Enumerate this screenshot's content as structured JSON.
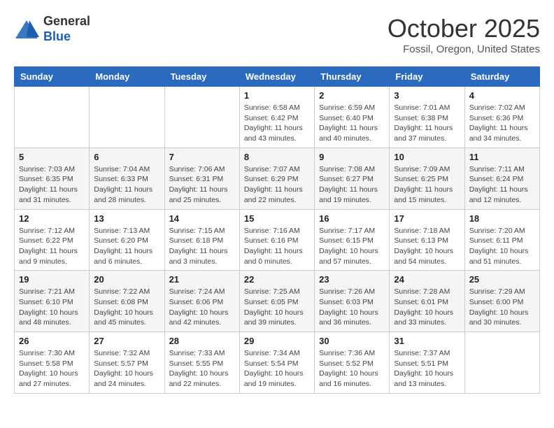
{
  "header": {
    "logo": {
      "line1": "General",
      "line2": "Blue"
    },
    "title": "October 2025",
    "location": "Fossil, Oregon, United States"
  },
  "weekdays": [
    "Sunday",
    "Monday",
    "Tuesday",
    "Wednesday",
    "Thursday",
    "Friday",
    "Saturday"
  ],
  "weeks": [
    [
      {
        "day": "",
        "info": ""
      },
      {
        "day": "",
        "info": ""
      },
      {
        "day": "",
        "info": ""
      },
      {
        "day": "1",
        "info": "Sunrise: 6:58 AM\nSunset: 6:42 PM\nDaylight: 11 hours\nand 43 minutes."
      },
      {
        "day": "2",
        "info": "Sunrise: 6:59 AM\nSunset: 6:40 PM\nDaylight: 11 hours\nand 40 minutes."
      },
      {
        "day": "3",
        "info": "Sunrise: 7:01 AM\nSunset: 6:38 PM\nDaylight: 11 hours\nand 37 minutes."
      },
      {
        "day": "4",
        "info": "Sunrise: 7:02 AM\nSunset: 6:36 PM\nDaylight: 11 hours\nand 34 minutes."
      }
    ],
    [
      {
        "day": "5",
        "info": "Sunrise: 7:03 AM\nSunset: 6:35 PM\nDaylight: 11 hours\nand 31 minutes."
      },
      {
        "day": "6",
        "info": "Sunrise: 7:04 AM\nSunset: 6:33 PM\nDaylight: 11 hours\nand 28 minutes."
      },
      {
        "day": "7",
        "info": "Sunrise: 7:06 AM\nSunset: 6:31 PM\nDaylight: 11 hours\nand 25 minutes."
      },
      {
        "day": "8",
        "info": "Sunrise: 7:07 AM\nSunset: 6:29 PM\nDaylight: 11 hours\nand 22 minutes."
      },
      {
        "day": "9",
        "info": "Sunrise: 7:08 AM\nSunset: 6:27 PM\nDaylight: 11 hours\nand 19 minutes."
      },
      {
        "day": "10",
        "info": "Sunrise: 7:09 AM\nSunset: 6:25 PM\nDaylight: 11 hours\nand 15 minutes."
      },
      {
        "day": "11",
        "info": "Sunrise: 7:11 AM\nSunset: 6:24 PM\nDaylight: 11 hours\nand 12 minutes."
      }
    ],
    [
      {
        "day": "12",
        "info": "Sunrise: 7:12 AM\nSunset: 6:22 PM\nDaylight: 11 hours\nand 9 minutes."
      },
      {
        "day": "13",
        "info": "Sunrise: 7:13 AM\nSunset: 6:20 PM\nDaylight: 11 hours\nand 6 minutes."
      },
      {
        "day": "14",
        "info": "Sunrise: 7:15 AM\nSunset: 6:18 PM\nDaylight: 11 hours\nand 3 minutes."
      },
      {
        "day": "15",
        "info": "Sunrise: 7:16 AM\nSunset: 6:16 PM\nDaylight: 11 hours\nand 0 minutes."
      },
      {
        "day": "16",
        "info": "Sunrise: 7:17 AM\nSunset: 6:15 PM\nDaylight: 10 hours\nand 57 minutes."
      },
      {
        "day": "17",
        "info": "Sunrise: 7:18 AM\nSunset: 6:13 PM\nDaylight: 10 hours\nand 54 minutes."
      },
      {
        "day": "18",
        "info": "Sunrise: 7:20 AM\nSunset: 6:11 PM\nDaylight: 10 hours\nand 51 minutes."
      }
    ],
    [
      {
        "day": "19",
        "info": "Sunrise: 7:21 AM\nSunset: 6:10 PM\nDaylight: 10 hours\nand 48 minutes."
      },
      {
        "day": "20",
        "info": "Sunrise: 7:22 AM\nSunset: 6:08 PM\nDaylight: 10 hours\nand 45 minutes."
      },
      {
        "day": "21",
        "info": "Sunrise: 7:24 AM\nSunset: 6:06 PM\nDaylight: 10 hours\nand 42 minutes."
      },
      {
        "day": "22",
        "info": "Sunrise: 7:25 AM\nSunset: 6:05 PM\nDaylight: 10 hours\nand 39 minutes."
      },
      {
        "day": "23",
        "info": "Sunrise: 7:26 AM\nSunset: 6:03 PM\nDaylight: 10 hours\nand 36 minutes."
      },
      {
        "day": "24",
        "info": "Sunrise: 7:28 AM\nSunset: 6:01 PM\nDaylight: 10 hours\nand 33 minutes."
      },
      {
        "day": "25",
        "info": "Sunrise: 7:29 AM\nSunset: 6:00 PM\nDaylight: 10 hours\nand 30 minutes."
      }
    ],
    [
      {
        "day": "26",
        "info": "Sunrise: 7:30 AM\nSunset: 5:58 PM\nDaylight: 10 hours\nand 27 minutes."
      },
      {
        "day": "27",
        "info": "Sunrise: 7:32 AM\nSunset: 5:57 PM\nDaylight: 10 hours\nand 24 minutes."
      },
      {
        "day": "28",
        "info": "Sunrise: 7:33 AM\nSunset: 5:55 PM\nDaylight: 10 hours\nand 22 minutes."
      },
      {
        "day": "29",
        "info": "Sunrise: 7:34 AM\nSunset: 5:54 PM\nDaylight: 10 hours\nand 19 minutes."
      },
      {
        "day": "30",
        "info": "Sunrise: 7:36 AM\nSunset: 5:52 PM\nDaylight: 10 hours\nand 16 minutes."
      },
      {
        "day": "31",
        "info": "Sunrise: 7:37 AM\nSunset: 5:51 PM\nDaylight: 10 hours\nand 13 minutes."
      },
      {
        "day": "",
        "info": ""
      }
    ]
  ]
}
